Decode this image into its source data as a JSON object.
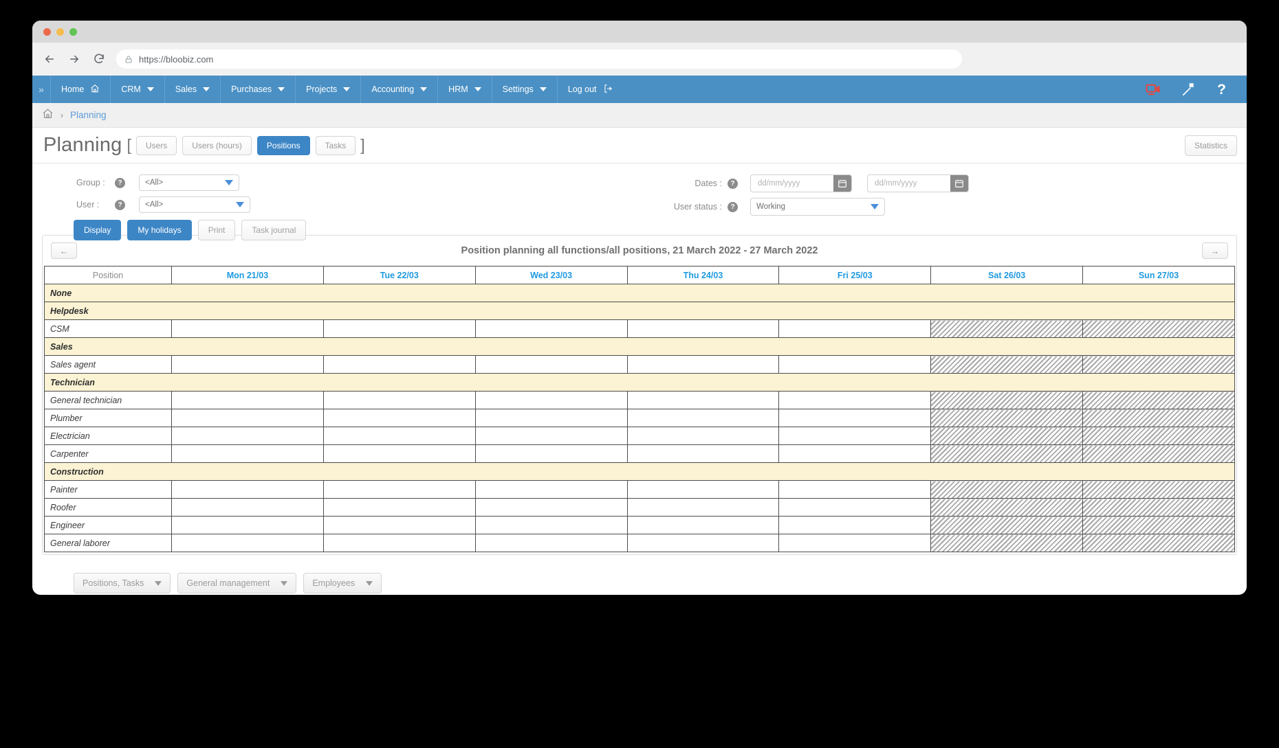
{
  "browser": {
    "url": "https://bloobiz.com",
    "back_icon": "back-arrow-icon",
    "forward_icon": "forward-arrow-icon",
    "reload_icon": "reload-icon",
    "lock_icon": "lock-icon"
  },
  "nav": {
    "expand_label": "»",
    "items": [
      {
        "label": "Home",
        "icon": "home-icon",
        "has_caret": false
      },
      {
        "label": "CRM",
        "icon": "",
        "has_caret": true
      },
      {
        "label": "Sales",
        "icon": "",
        "has_caret": true
      },
      {
        "label": "Purchases",
        "icon": "",
        "has_caret": true
      },
      {
        "label": "Projects",
        "icon": "",
        "has_caret": true
      },
      {
        "label": "Accounting",
        "icon": "",
        "has_caret": true
      },
      {
        "label": "HRM",
        "icon": "",
        "has_caret": true
      },
      {
        "label": "Settings",
        "icon": "",
        "has_caret": true
      },
      {
        "label": "Log out",
        "icon": "logout-icon",
        "has_caret": false
      }
    ],
    "right_icons": [
      {
        "name": "video-record-icon",
        "color": "#e8453c"
      },
      {
        "name": "magic-wand-icon",
        "color": "#ffffff"
      },
      {
        "name": "help-question-icon",
        "color": "#ffffff"
      }
    ]
  },
  "breadcrumb": {
    "home_icon": "home-icon",
    "separator": "›",
    "current": "Planning"
  },
  "header": {
    "title": "Planning",
    "bracket_open": "[",
    "bracket_close": "]",
    "tabs": [
      {
        "label": "Users",
        "active": false
      },
      {
        "label": "Users (hours)",
        "active": false
      },
      {
        "label": "Positions",
        "active": true
      },
      {
        "label": "Tasks",
        "active": false
      }
    ],
    "statistics_label": "Statistics"
  },
  "filters": {
    "group_label": "Group :",
    "group_value": "<All>",
    "user_label": "User :",
    "user_value": "<All>",
    "dates_label": "Dates :",
    "date_from_placeholder": "dd/mm/yyyy",
    "date_to_placeholder": "dd/mm/yyyy",
    "user_status_label": "User status :",
    "user_status_value": "Working",
    "help_glyph": "?",
    "calendar_icon": "calendar-icon",
    "buttons": [
      {
        "label": "Display",
        "primary": true
      },
      {
        "label": "My holidays",
        "primary": true
      },
      {
        "label": "Print",
        "primary": false
      },
      {
        "label": "Task journal",
        "primary": false
      }
    ]
  },
  "planning": {
    "prev_label": "←",
    "next_label": "→",
    "title": "Position planning all functions/all positions, 21 March 2022 - 27 March 2022",
    "columns": [
      "Position",
      "Mon 21/03",
      "Tue 22/03",
      "Wed 23/03",
      "Thu 24/03",
      "Fri 25/03",
      "Sat 26/03",
      "Sun 27/03"
    ],
    "weekend_column_indexes": [
      5,
      6
    ],
    "rows": [
      {
        "type": "group",
        "label": "None"
      },
      {
        "type": "group",
        "label": "Helpdesk"
      },
      {
        "type": "position",
        "label": "CSM"
      },
      {
        "type": "group",
        "label": "Sales"
      },
      {
        "type": "position",
        "label": "Sales agent"
      },
      {
        "type": "group",
        "label": "Technician"
      },
      {
        "type": "position",
        "label": "General technician"
      },
      {
        "type": "position",
        "label": "Plumber"
      },
      {
        "type": "position",
        "label": "Electrician"
      },
      {
        "type": "position",
        "label": "Carpenter"
      },
      {
        "type": "group",
        "label": "Construction"
      },
      {
        "type": "position",
        "label": "Painter"
      },
      {
        "type": "position",
        "label": "Roofer"
      },
      {
        "type": "position",
        "label": "Engineer"
      },
      {
        "type": "position",
        "label": "General laborer"
      }
    ]
  },
  "footer": {
    "dropdowns": [
      {
        "label": "Positions, Tasks"
      },
      {
        "label": "General management"
      },
      {
        "label": "Employees"
      }
    ]
  },
  "colors": {
    "nav_blue": "#4a90c4",
    "accent_blue": "#3d86c6",
    "day_header_blue": "#1f9ae0",
    "group_row_cream": "#fbf3d3",
    "record_red": "#e8453c"
  }
}
